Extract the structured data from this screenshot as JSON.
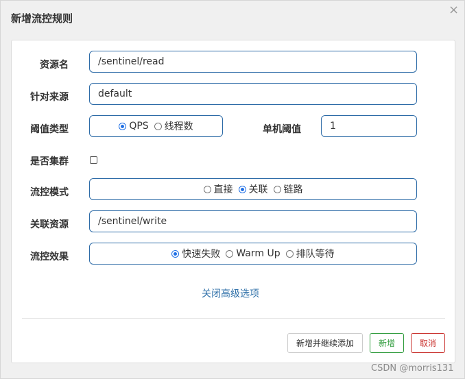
{
  "dialog": {
    "title": "新增流控规则",
    "close": "×"
  },
  "form": {
    "resource": {
      "label": "资源名",
      "value": "/sentinel/read"
    },
    "source": {
      "label": "针对来源",
      "value": "default"
    },
    "threshold_type": {
      "label": "阈值类型",
      "options": [
        "QPS",
        "线程数"
      ],
      "selected": "QPS"
    },
    "single_threshold": {
      "label": "单机阈值",
      "value": "1"
    },
    "cluster": {
      "label": "是否集群",
      "checked": false
    },
    "mode": {
      "label": "流控模式",
      "options": [
        "直接",
        "关联",
        "链路"
      ],
      "selected": "关联"
    },
    "ref_resource": {
      "label": "关联资源",
      "value": "/sentinel/write"
    },
    "effect": {
      "label": "流控效果",
      "options": [
        "快速失败",
        "Warm Up",
        "排队等待"
      ],
      "selected": "快速失败"
    },
    "advanced_link": "关闭高级选项"
  },
  "buttons": {
    "add_continue": "新增并继续添加",
    "add": "新增",
    "cancel": "取消"
  },
  "watermark": "CSDN @morris131",
  "colors": {
    "primary_border": "#2d6ba7",
    "link": "#3071a9",
    "add": "#2e9b3b",
    "cancel": "#c9302c"
  }
}
